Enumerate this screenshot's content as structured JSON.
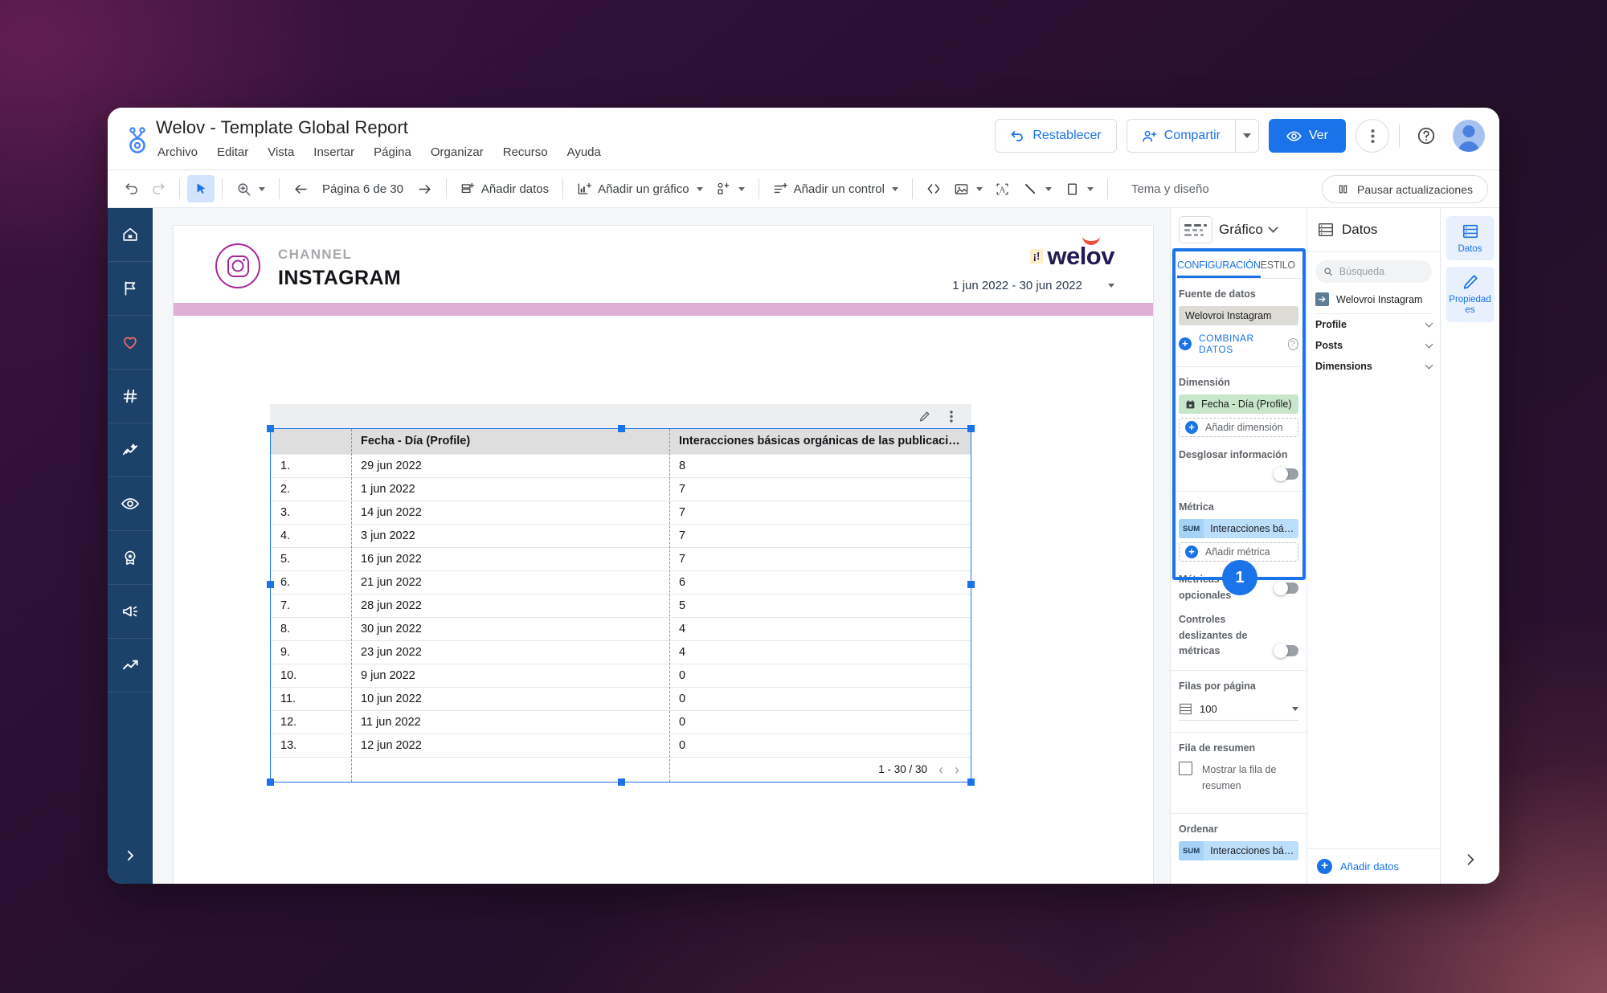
{
  "window": {
    "doc_title": "Welov - Template Global Report",
    "menu": [
      "Archivo",
      "Editar",
      "Vista",
      "Insertar",
      "Página",
      "Organizar",
      "Recurso",
      "Ayuda"
    ],
    "actions": {
      "reset": "Restablecer",
      "share": "Compartir",
      "view": "Ver",
      "more_icon": "kebab-menu-icon",
      "help_icon": "help-circle-icon",
      "avatar_icon": "user-avatar"
    }
  },
  "toolbar": {
    "undo_icon": "undo-icon",
    "redo_icon": "redo-icon",
    "select_icon": "cursor-arrow-icon",
    "zoom_icon": "zoom-icon",
    "page_label": "Página 6 de 30",
    "add_data": "Añadir datos",
    "add_chart": "Añadir un gráfico",
    "add_component_icon": "add-component-icon",
    "add_control": "Añadir un control",
    "embed_icon": "embed-code-icon",
    "image_icon": "image-icon",
    "text_icon": "text-box-icon",
    "line_icon": "line-icon",
    "shape_icon": "rectangle-icon",
    "theme": "Tema y diseño",
    "pause": "Pausar actualizaciones"
  },
  "left_rail": {
    "items": [
      {
        "name": "home-icon"
      },
      {
        "name": "flag-icon"
      },
      {
        "name": "heart-icon"
      },
      {
        "name": "hashtag-icon"
      },
      {
        "name": "sparkle-chart-icon"
      },
      {
        "name": "eye-icon"
      },
      {
        "name": "award-badge-icon"
      },
      {
        "name": "megaphone-icon"
      },
      {
        "name": "trending-up-icon"
      }
    ],
    "expand_icon": "chevron-right-icon"
  },
  "report": {
    "channel_label": "CHANNEL",
    "channel_name": "INSTAGRAM",
    "channel_icon": "instagram-icon",
    "brand": {
      "badge": "¡!",
      "word": "welov"
    },
    "date_range": "1 jun 2022 - 30 jun 2022",
    "band_color": "#dfafd8",
    "table": {
      "edit_icon": "pencil-icon",
      "menu_icon": "kebab-menu-icon",
      "columns": [
        "",
        "Fecha - Día (Profile)",
        "Interacciones básicas orgánicas de las publicaciones (Pro…"
      ],
      "rows": [
        {
          "idx": "1.",
          "fecha": "29 jun 2022",
          "valor": "8"
        },
        {
          "idx": "2.",
          "fecha": "1 jun 2022",
          "valor": "7"
        },
        {
          "idx": "3.",
          "fecha": "14 jun 2022",
          "valor": "7"
        },
        {
          "idx": "4.",
          "fecha": "3 jun 2022",
          "valor": "7"
        },
        {
          "idx": "5.",
          "fecha": "16 jun 2022",
          "valor": "7"
        },
        {
          "idx": "6.",
          "fecha": "21 jun 2022",
          "valor": "6"
        },
        {
          "idx": "7.",
          "fecha": "28 jun 2022",
          "valor": "5"
        },
        {
          "idx": "8.",
          "fecha": "30 jun 2022",
          "valor": "4"
        },
        {
          "idx": "9.",
          "fecha": "23 jun 2022",
          "valor": "4"
        },
        {
          "idx": "10.",
          "fecha": "9 jun 2022",
          "valor": "0"
        },
        {
          "idx": "11.",
          "fecha": "10 jun 2022",
          "valor": "0"
        },
        {
          "idx": "12.",
          "fecha": "11 jun 2022",
          "valor": "0"
        },
        {
          "idx": "13.",
          "fecha": "12 jun 2022",
          "valor": "0"
        }
      ],
      "pagination": "1 - 30 / 30",
      "prev_icon": "chevron-left-icon",
      "next_icon": "chevron-right-icon"
    }
  },
  "chart_panel": {
    "title": "Gráfico",
    "chart_type_icon": "table-chart-icon",
    "collapse_icon": "chevron-down-icon",
    "tabs": [
      {
        "label": "CONFIGURACIÓN",
        "selected": true
      },
      {
        "label": "ESTILO",
        "selected": false
      }
    ],
    "data_source": {
      "section_title": "Fuente de datos",
      "value": "Welovroi Instagram",
      "blend": "COMBINAR DATOS",
      "help_icon": "help-circle-icon"
    },
    "dimension": {
      "section_title": "Dimensión",
      "chip": "Fecha - Día (Profile)",
      "chip_icon": "calendar-icon",
      "add": "Añadir dimensión",
      "drilldown_label": "Desglosar información",
      "drilldown_on": false
    },
    "metric": {
      "section_title": "Métrica",
      "agg": "SUM",
      "chip": "Interacciones bási…",
      "add": "Añadir métrica",
      "optional_label": "Métricas opcionales",
      "optional_on": false,
      "sliders_label": "Controles deslizantes de métricas",
      "sliders_on": false
    },
    "rows_per_page": {
      "section_title": "Filas por página",
      "value": "100",
      "icon": "rows-icon"
    },
    "summary_row": {
      "section_title": "Fila de resumen",
      "checkbox_label": "Mostrar la fila de resumen",
      "checked": false
    },
    "sort": {
      "section_title": "Ordenar",
      "agg": "SUM",
      "chip": "Interacciones bási…"
    },
    "highlight": {
      "step_number": "1",
      "color": "#1a73e8"
    }
  },
  "data_panel": {
    "title": "Datos",
    "title_icon": "data-table-icon",
    "search_placeholder": "Búsqueda",
    "search_value": "",
    "search_icon": "search-icon",
    "source": {
      "name": "Welovroi Instagram",
      "icon": "data-source-icon"
    },
    "fields": [
      {
        "label": "Profile",
        "icon": "chevron-down-icon"
      },
      {
        "label": "Posts",
        "icon": "chevron-down-icon"
      },
      {
        "label": "Dimensions",
        "icon": "chevron-down-icon"
      }
    ],
    "add_data": "Añadir datos",
    "add_icon": "plus-circle-icon"
  },
  "right_rail": {
    "items": [
      {
        "label": "Datos",
        "icon": "data-table-icon"
      },
      {
        "label": "Propiedades",
        "icon": "pencil-icon"
      }
    ],
    "collapse_icon": "chevron-right-icon"
  }
}
